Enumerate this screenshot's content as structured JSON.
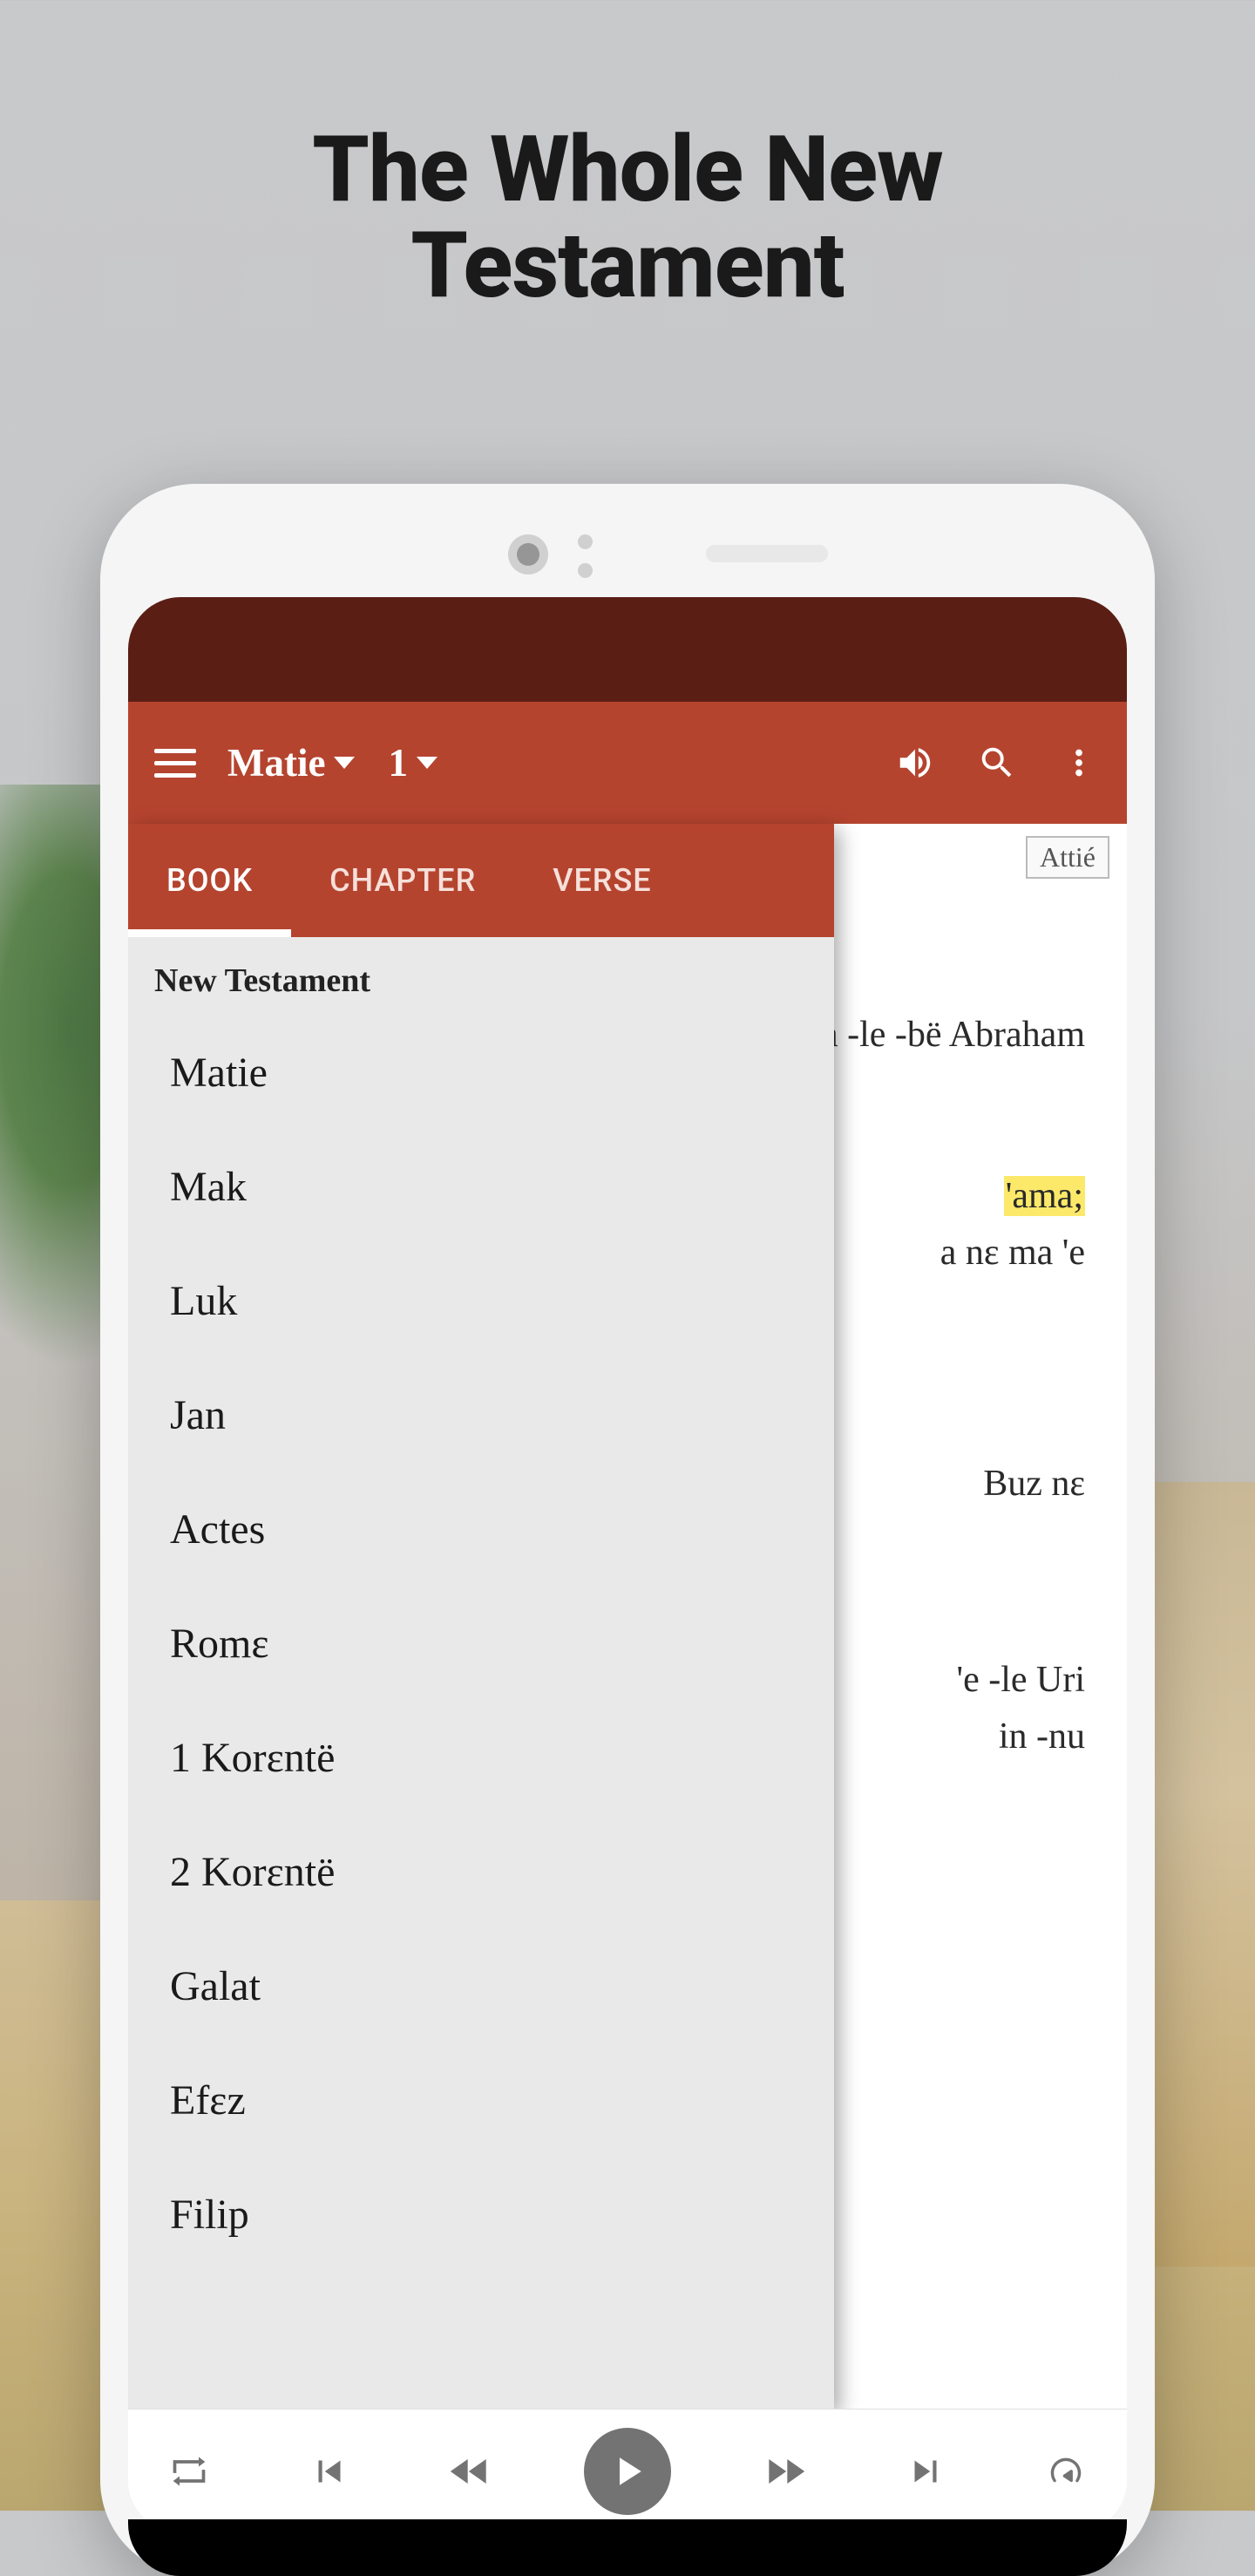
{
  "marketing": {
    "title_line1": "The Whole New",
    "title_line2": "Testament"
  },
  "toolbar": {
    "book": "Matie",
    "chapter": "1"
  },
  "language_badge": "Attié",
  "tabs": {
    "book": "BOOK",
    "chapter": "CHAPTER",
    "verse": "VERSE"
  },
  "dropdown": {
    "section": "New Testament",
    "books": [
      "Matie",
      "Mak",
      "Luk",
      "Jan",
      "Actes",
      "Romɛ",
      "1 Korɛntë",
      "2 Korɛntë",
      "Galat",
      "Efɛz",
      "Filip"
    ]
  },
  "verses": {
    "v1": "a -le -bë Abraham",
    "v2a": "'ama;",
    "v2b": "a nɛ ma 'e",
    "v3": "Buz nɛ",
    "v4a": "'e -le Uri",
    "v4b": "in -nu"
  }
}
